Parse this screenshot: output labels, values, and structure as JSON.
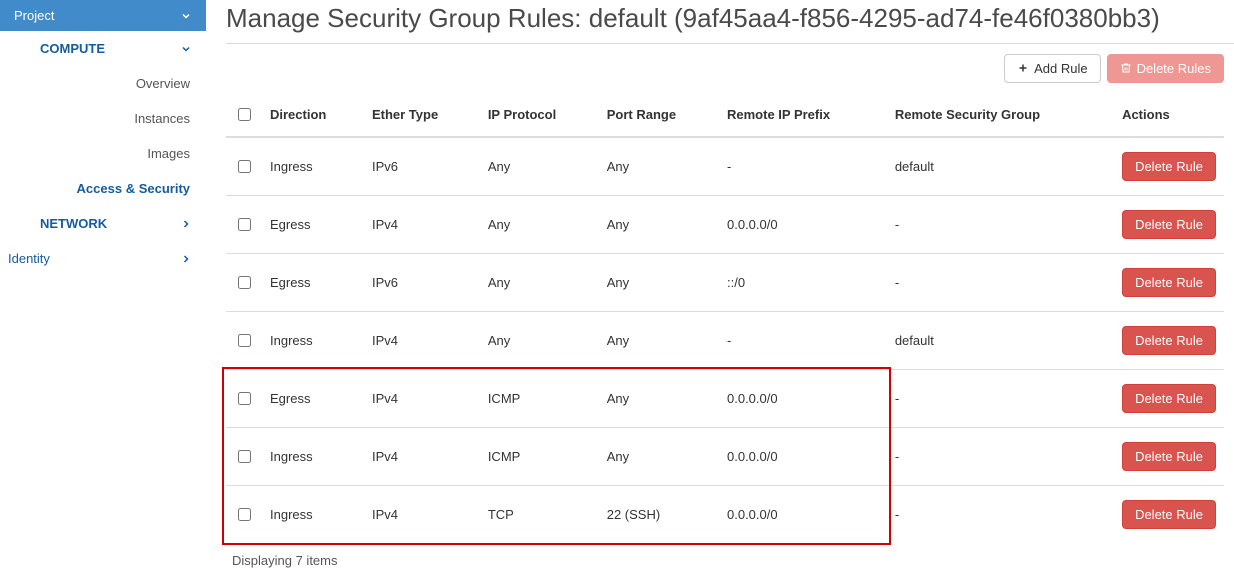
{
  "sidebar": {
    "project_label": "Project",
    "compute_label": "COMPUTE",
    "compute_items": [
      {
        "label": "Overview"
      },
      {
        "label": "Instances"
      },
      {
        "label": "Images"
      },
      {
        "label": "Access & Security"
      }
    ],
    "network_label": "NETWORK",
    "identity_label": "Identity"
  },
  "page": {
    "title": "Manage Security Group Rules: default (9af45aa4-f856-4295-ad74-fe46f0380bb3)"
  },
  "toolbar": {
    "add_rule_label": "Add Rule",
    "delete_rules_label": "Delete Rules"
  },
  "table": {
    "headers": {
      "direction": "Direction",
      "ether_type": "Ether Type",
      "ip_protocol": "IP Protocol",
      "port_range": "Port Range",
      "remote_ip_prefix": "Remote IP Prefix",
      "remote_sg": "Remote Security Group",
      "actions": "Actions"
    },
    "delete_rule_label": "Delete Rule",
    "rows": [
      {
        "direction": "Ingress",
        "ether": "IPv6",
        "proto": "Any",
        "port": "Any",
        "prefix": "-",
        "sg": "default"
      },
      {
        "direction": "Egress",
        "ether": "IPv4",
        "proto": "Any",
        "port": "Any",
        "prefix": "0.0.0.0/0",
        "sg": "-"
      },
      {
        "direction": "Egress",
        "ether": "IPv6",
        "proto": "Any",
        "port": "Any",
        "prefix": "::/0",
        "sg": "-"
      },
      {
        "direction": "Ingress",
        "ether": "IPv4",
        "proto": "Any",
        "port": "Any",
        "prefix": "-",
        "sg": "default"
      },
      {
        "direction": "Egress",
        "ether": "IPv4",
        "proto": "ICMP",
        "port": "Any",
        "prefix": "0.0.0.0/0",
        "sg": "-"
      },
      {
        "direction": "Ingress",
        "ether": "IPv4",
        "proto": "ICMP",
        "port": "Any",
        "prefix": "0.0.0.0/0",
        "sg": "-"
      },
      {
        "direction": "Ingress",
        "ether": "IPv4",
        "proto": "TCP",
        "port": "22 (SSH)",
        "prefix": "0.0.0.0/0",
        "sg": "-"
      }
    ],
    "footer": "Displaying 7 items"
  }
}
